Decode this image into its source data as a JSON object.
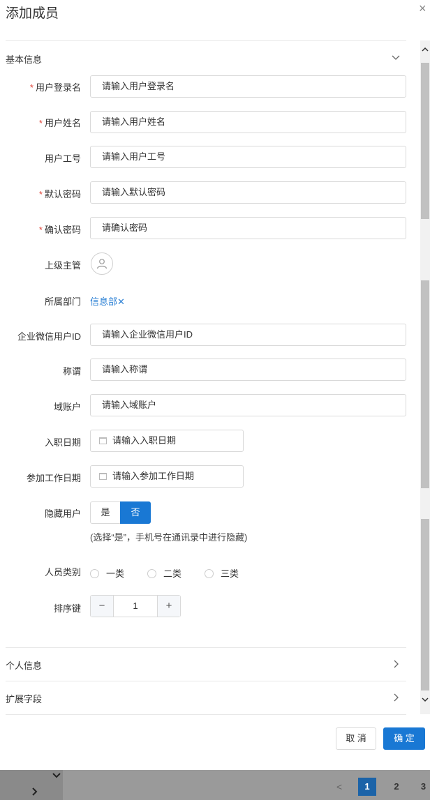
{
  "dialog": {
    "title": "添加成员",
    "close_icon": "×"
  },
  "basic_section": {
    "title": "基本信息",
    "collapse_icon": "chevron-down-icon"
  },
  "fields": {
    "login_name": {
      "label": "用户登录名",
      "placeholder": "请输入用户登录名",
      "required": true
    },
    "user_name": {
      "label": "用户姓名",
      "placeholder": "请输入用户姓名",
      "required": true
    },
    "employee_no": {
      "label": "用户工号",
      "placeholder": "请输入用户工号",
      "required": false
    },
    "default_password": {
      "label": "默认密码",
      "placeholder": "请输入默认密码",
      "required": true
    },
    "confirm_password": {
      "label": "确认密码",
      "placeholder": "请确认密码",
      "required": true
    },
    "supervisor": {
      "label": "上级主管"
    },
    "department": {
      "label": "所属部门",
      "value": "信息部",
      "remove": "✕"
    },
    "wechat_id": {
      "label": "企业微信用户ID",
      "placeholder": "请输入企业微信用户ID"
    },
    "title": {
      "label": "称谓",
      "placeholder": "请输入称谓"
    },
    "domain_account": {
      "label": "域账户",
      "placeholder": "请输入域账户"
    },
    "hire_date": {
      "label": "入职日期",
      "placeholder": "请输入入职日期"
    },
    "work_start_date": {
      "label": "参加工作日期",
      "placeholder": "请输入参加工作日期"
    },
    "hidden_user": {
      "label": "隐藏用户",
      "options": [
        "是",
        "否"
      ],
      "selected": "否",
      "hint": "(选择“是”，手机号在通讯录中进行隐藏)"
    },
    "staff_category": {
      "label": "人员类别",
      "options": [
        "一类",
        "二类",
        "三类"
      ]
    },
    "sort_key": {
      "label": "排序键",
      "value": "1",
      "minus": "−",
      "plus": "+"
    }
  },
  "collapsed_sections": [
    {
      "title": "个人信息"
    },
    {
      "title": "扩展字段"
    }
  ],
  "footer": {
    "cancel_label": "取 消",
    "ok_label": "确 定"
  },
  "background_pager": {
    "prev": "<",
    "pages": [
      "1",
      "2",
      "3"
    ],
    "current": "1"
  },
  "colors": {
    "accent": "#1978d4",
    "required": "#e0463a",
    "link": "#2a7fd4"
  }
}
